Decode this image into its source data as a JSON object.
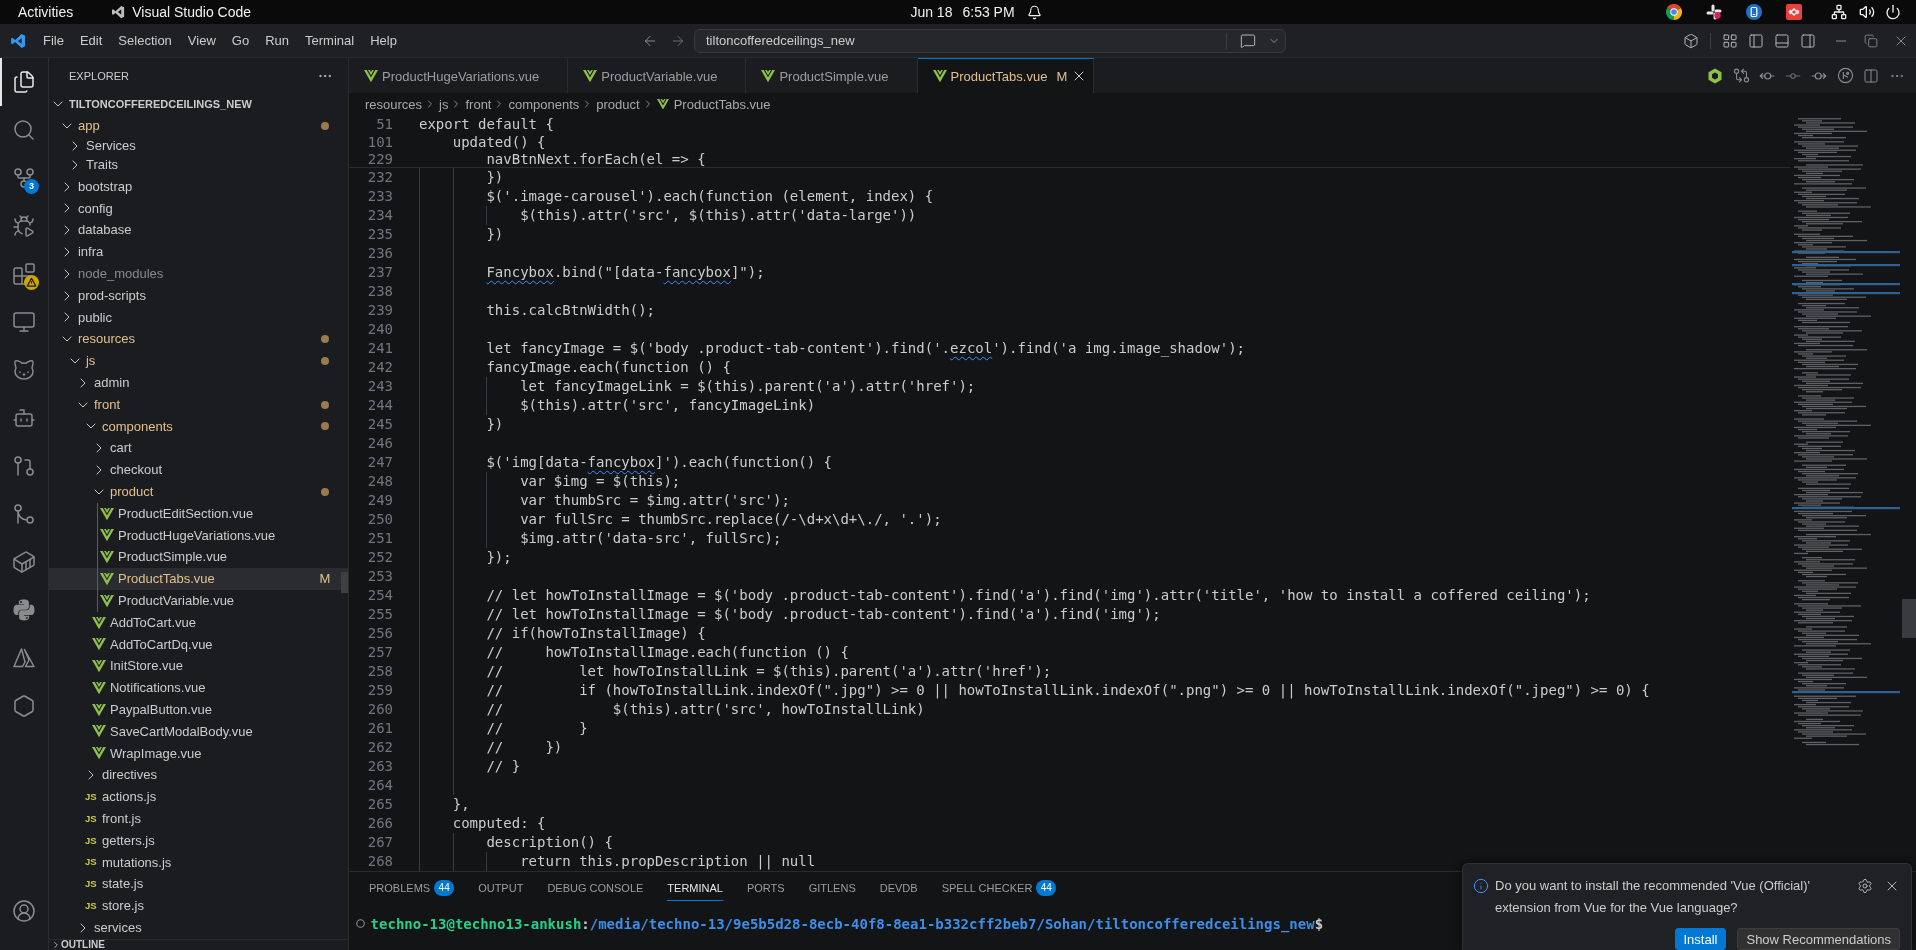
{
  "system_bar": {
    "activities": "Activities",
    "app_name": "Visual Studio Code",
    "date": "Jun 18",
    "time": "6:53 PM"
  },
  "title_bar": {
    "menu": [
      "File",
      "Edit",
      "Selection",
      "View",
      "Go",
      "Run",
      "Terminal",
      "Help"
    ],
    "command_center": "tiltoncofferedceilings_new"
  },
  "activity_bar": {
    "items": [
      {
        "kind": "explorer",
        "selected": true
      },
      {
        "kind": "search",
        "selected": false
      },
      {
        "kind": "source_control",
        "selected": false,
        "badge": {
          "kind": "count",
          "text": "3"
        }
      },
      {
        "kind": "run_debug",
        "selected": false
      },
      {
        "kind": "extensions",
        "selected": false,
        "badge": {
          "kind": "warning"
        }
      },
      {
        "kind": "remote",
        "selected": false
      },
      {
        "kind": "cat",
        "selected": false
      },
      {
        "kind": "robot",
        "selected": false
      },
      {
        "kind": "pull_request",
        "selected": false
      },
      {
        "kind": "merge",
        "selected": false
      },
      {
        "kind": "container",
        "selected": false
      },
      {
        "kind": "snakes",
        "selected": false
      },
      {
        "kind": "triangles",
        "selected": false
      },
      {
        "kind": "hexagon",
        "selected": false
      }
    ],
    "bottom": [
      {
        "kind": "account"
      }
    ]
  },
  "sidebar": {
    "title": "EXPLORER",
    "folder": {
      "label": "TILTONCOFFEREDCEILINGS_NEW",
      "expanded": true,
      "children": [
        {
          "label": "app",
          "kind": "folder",
          "expanded": true,
          "modified": true,
          "ignored": false,
          "selected": false,
          "children": [
            {
              "label": "Services",
              "kind": "folder",
              "expanded": false,
              "modified": false,
              "ignored": false,
              "selected": false
            },
            {
              "label": "Traits",
              "kind": "folder",
              "expanded": false,
              "modified": false,
              "ignored": false,
              "selected": false
            }
          ]
        },
        {
          "label": "bootstrap",
          "kind": "folder",
          "expanded": false,
          "modified": false,
          "ignored": false,
          "selected": false
        },
        {
          "label": "config",
          "kind": "folder",
          "expanded": false,
          "modified": false,
          "ignored": false,
          "selected": false
        },
        {
          "label": "database",
          "kind": "folder",
          "expanded": false,
          "modified": false,
          "ignored": false,
          "selected": false
        },
        {
          "label": "infra",
          "kind": "folder",
          "expanded": false,
          "modified": false,
          "ignored": false,
          "selected": false
        },
        {
          "label": "node_modules",
          "kind": "folder",
          "expanded": false,
          "modified": false,
          "ignored": true,
          "selected": false
        },
        {
          "label": "prod-scripts",
          "kind": "folder",
          "expanded": false,
          "modified": false,
          "ignored": false,
          "selected": false
        },
        {
          "label": "public",
          "kind": "folder",
          "expanded": false,
          "modified": false,
          "ignored": false,
          "selected": false
        },
        {
          "label": "resources",
          "kind": "folder",
          "expanded": true,
          "modified": true,
          "ignored": false,
          "selected": false,
          "children": [
            {
              "label": "js",
              "kind": "folder",
              "expanded": true,
              "modified": true,
              "ignored": false,
              "selected": false,
              "children": [
                {
                  "label": "admin",
                  "kind": "folder",
                  "expanded": false,
                  "modified": false,
                  "ignored": false,
                  "selected": false
                },
                {
                  "label": "front",
                  "kind": "folder",
                  "expanded": true,
                  "modified": true,
                  "ignored": false,
                  "selected": false,
                  "children": [
                    {
                      "label": "components",
                      "kind": "folder",
                      "expanded": true,
                      "modified": true,
                      "ignored": false,
                      "selected": false,
                      "children": [
                        {
                          "label": "cart",
                          "kind": "folder",
                          "expanded": false,
                          "modified": false,
                          "ignored": false,
                          "selected": false
                        },
                        {
                          "label": "checkout",
                          "kind": "folder",
                          "expanded": false,
                          "modified": false,
                          "ignored": false,
                          "selected": false
                        },
                        {
                          "label": "product",
                          "kind": "folder",
                          "expanded": true,
                          "modified": true,
                          "ignored": false,
                          "selected": false,
                          "children": [
                            {
                              "label": "ProductEditSection.vue",
                              "kind": "vue",
                              "modified": false,
                              "ignored": false,
                              "selected": false
                            },
                            {
                              "label": "ProductHugeVariations.vue",
                              "kind": "vue",
                              "modified": false,
                              "ignored": false,
                              "selected": false
                            },
                            {
                              "label": "ProductSimple.vue",
                              "kind": "vue",
                              "modified": false,
                              "ignored": false,
                              "selected": false
                            },
                            {
                              "label": "ProductTabs.vue",
                              "kind": "vue",
                              "modified": true,
                              "ignored": false,
                              "selected": true,
                              "badge": "M"
                            },
                            {
                              "label": "ProductVariable.vue",
                              "kind": "vue",
                              "modified": false,
                              "ignored": false,
                              "selected": false
                            }
                          ]
                        },
                        {
                          "label": "AddToCart.vue",
                          "kind": "vue",
                          "modified": false,
                          "ignored": false,
                          "selected": false
                        },
                        {
                          "label": "AddToCartDq.vue",
                          "kind": "vue",
                          "modified": false,
                          "ignored": false,
                          "selected": false
                        },
                        {
                          "label": "InitStore.vue",
                          "kind": "vue",
                          "modified": false,
                          "ignored": false,
                          "selected": false
                        },
                        {
                          "label": "Notifications.vue",
                          "kind": "vue",
                          "modified": false,
                          "ignored": false,
                          "selected": false
                        },
                        {
                          "label": "PaypalButton.vue",
                          "kind": "vue",
                          "modified": false,
                          "ignored": false,
                          "selected": false
                        },
                        {
                          "label": "SaveCartModalBody.vue",
                          "kind": "vue",
                          "modified": false,
                          "ignored": false,
                          "selected": false
                        },
                        {
                          "label": "WrapImage.vue",
                          "kind": "vue",
                          "modified": false,
                          "ignored": false,
                          "selected": false
                        }
                      ]
                    },
                    {
                      "label": "directives",
                      "kind": "folder",
                      "expanded": false,
                      "modified": false,
                      "ignored": false,
                      "selected": false
                    },
                    {
                      "label": "actions.js",
                      "kind": "js",
                      "icon_label": "JS",
                      "modified": false,
                      "ignored": false,
                      "selected": false
                    },
                    {
                      "label": "front.js",
                      "kind": "js",
                      "icon_label": "JS",
                      "modified": false,
                      "ignored": false,
                      "selected": false
                    },
                    {
                      "label": "getters.js",
                      "kind": "js",
                      "icon_label": "JS",
                      "modified": false,
                      "ignored": false,
                      "selected": false
                    },
                    {
                      "label": "mutations.js",
                      "kind": "js",
                      "icon_label": "JS",
                      "modified": false,
                      "ignored": false,
                      "selected": false
                    },
                    {
                      "label": "state.js",
                      "kind": "js",
                      "icon_label": "JS",
                      "modified": false,
                      "ignored": false,
                      "selected": false
                    },
                    {
                      "label": "store.js",
                      "kind": "js",
                      "icon_label": "JS",
                      "modified": false,
                      "ignored": false,
                      "selected": false
                    }
                  ]
                },
                {
                  "label": "services",
                  "kind": "folder",
                  "expanded": false,
                  "modified": false,
                  "ignored": false,
                  "selected": false
                }
              ]
            }
          ]
        }
      ]
    },
    "sections": [
      {
        "label": "OUTLINE",
        "expanded": false
      }
    ]
  },
  "editor": {
    "tabs": [
      {
        "label": "ProductHugeVariations.vue",
        "selected": false,
        "modified": false
      },
      {
        "label": "ProductVariable.vue",
        "selected": false,
        "modified": false
      },
      {
        "label": "ProductSimple.vue",
        "selected": false,
        "modified": false
      },
      {
        "label": "ProductTabs.vue",
        "selected": true,
        "modified": true,
        "badge": "M"
      }
    ],
    "breadcrumb": [
      {
        "label": "resources",
        "kind": "folder"
      },
      {
        "label": "js",
        "kind": "folder"
      },
      {
        "label": "front",
        "kind": "folder"
      },
      {
        "label": "components",
        "kind": "folder"
      },
      {
        "label": "product",
        "kind": "folder"
      },
      {
        "label": "ProductTabs.vue",
        "kind": "vue"
      }
    ],
    "sticky_lines": [
      {
        "number": "51",
        "text": "export default {"
      },
      {
        "number": "101",
        "text": "    updated() {"
      },
      {
        "number": "229",
        "text": "        navBtnNext.forEach(el => {"
      }
    ],
    "lines": [
      {
        "number": "232",
        "text": "        })"
      },
      {
        "number": "233",
        "text": "        $('.image-carousel').each(function (element, index) {"
      },
      {
        "number": "234",
        "text": "            $(this).attr('src', $(this).attr('data-large'))"
      },
      {
        "number": "235",
        "text": "        })"
      },
      {
        "number": "236"
      },
      {
        "number": "237",
        "segments": [
          {
            "text": "        Fancybox",
            "misspelled": true
          },
          {
            "text": ".bind(\"[data-",
            "misspelled": false
          },
          {
            "text": "fancybox",
            "misspelled": true
          },
          {
            "text": "]\");",
            "misspelled": false
          }
        ]
      },
      {
        "number": "238"
      },
      {
        "number": "239",
        "text": "        this.calcBtnWidth();"
      },
      {
        "number": "240"
      },
      {
        "number": "241",
        "segments": [
          {
            "text": "        let fancyImage = $('body .product-tab-content').find('.",
            "misspelled": false
          },
          {
            "text": "ezcol",
            "misspelled": true
          },
          {
            "text": "').find('a img.image_shadow');",
            "misspelled": false
          }
        ]
      },
      {
        "number": "242",
        "text": "        fancyImage.each(function () {"
      },
      {
        "number": "243",
        "text": "            let fancyImageLink = $(this).parent('a').attr('href');"
      },
      {
        "number": "244",
        "text": "            $(this).attr('src', fancyImageLink)"
      },
      {
        "number": "245",
        "text": "        })"
      },
      {
        "number": "246"
      },
      {
        "number": "247",
        "segments": [
          {
            "text": "        $('img[data-",
            "misspelled": false
          },
          {
            "text": "fancybox",
            "misspelled": true
          },
          {
            "text": "]').each(function() {",
            "misspelled": false
          }
        ]
      },
      {
        "number": "248",
        "text": "            var $img = $(this);"
      },
      {
        "number": "249",
        "text": "            var thumbSrc = $img.attr('src');"
      },
      {
        "number": "250",
        "text": "            var fullSrc = thumbSrc.replace(/-\\d+x\\d+\\./, '.');"
      },
      {
        "number": "251",
        "text": "            $img.attr('data-src', fullSrc);"
      },
      {
        "number": "252",
        "text": "        });"
      },
      {
        "number": "253"
      },
      {
        "number": "254",
        "text": "        // let howToInstallImage = $('body .product-tab-content').find('a').find('img').attr('title', 'how to install a coffered ceiling');"
      },
      {
        "number": "255",
        "text": "        // let howToInstallImage = $('body .product-tab-content').find('a').find('img');"
      },
      {
        "number": "256",
        "text": "        // if(howToInstallImage) {"
      },
      {
        "number": "257",
        "text": "        //     howToInstallImage.each(function () {"
      },
      {
        "number": "258",
        "text": "        //         let howToInstallLink = $(this).parent('a').attr('href');"
      },
      {
        "number": "259",
        "text": "        //         if (howToInstallLink.indexOf(\".jpg\") >= 0 || howToInstallLink.indexOf(\".png\") >= 0 || howToInstallLink.indexOf(\".jpeg\") >= 0) {"
      },
      {
        "number": "260",
        "text": "        //             $(this).attr('src', howToInstallLink)"
      },
      {
        "number": "261",
        "text": "        //         }"
      },
      {
        "number": "262",
        "text": "        //     })"
      },
      {
        "number": "263",
        "text": "        // }"
      },
      {
        "number": "264"
      },
      {
        "number": "265",
        "text": "    },"
      },
      {
        "number": "266",
        "text": "    computed: {"
      },
      {
        "number": "267",
        "text": "        description() {"
      },
      {
        "number": "268",
        "text": "            return this.propDescription || null"
      }
    ]
  },
  "panel": {
    "tabs": [
      {
        "label": "PROBLEMS",
        "badge": "44",
        "selected": false
      },
      {
        "label": "OUTPUT",
        "selected": false
      },
      {
        "label": "DEBUG CONSOLE",
        "selected": false
      },
      {
        "label": "TERMINAL",
        "selected": true
      },
      {
        "label": "PORTS",
        "selected": false
      },
      {
        "label": "GITLENS",
        "selected": false
      },
      {
        "label": "DEVDB",
        "selected": false
      },
      {
        "label": "SPELL CHECKER",
        "badge": "44",
        "selected": false
      }
    ],
    "terminal": {
      "user_host": "techno-13@techno13-ankush",
      "separator": ":",
      "path": "/media/techno-13/9e5b5d28-8ecb-40f8-8ea1-b332cff2beb7/Sohan/tiltoncofferedceilings_new",
      "symbol": "$"
    }
  },
  "notification": {
    "message": "Do you want to install the recommended 'Vue (Official)' extension from Vue for the Vue language?",
    "buttons": [
      {
        "label": "Install",
        "kind": "primary"
      },
      {
        "label": "Show Recommendations",
        "kind": "secondary"
      }
    ]
  }
}
